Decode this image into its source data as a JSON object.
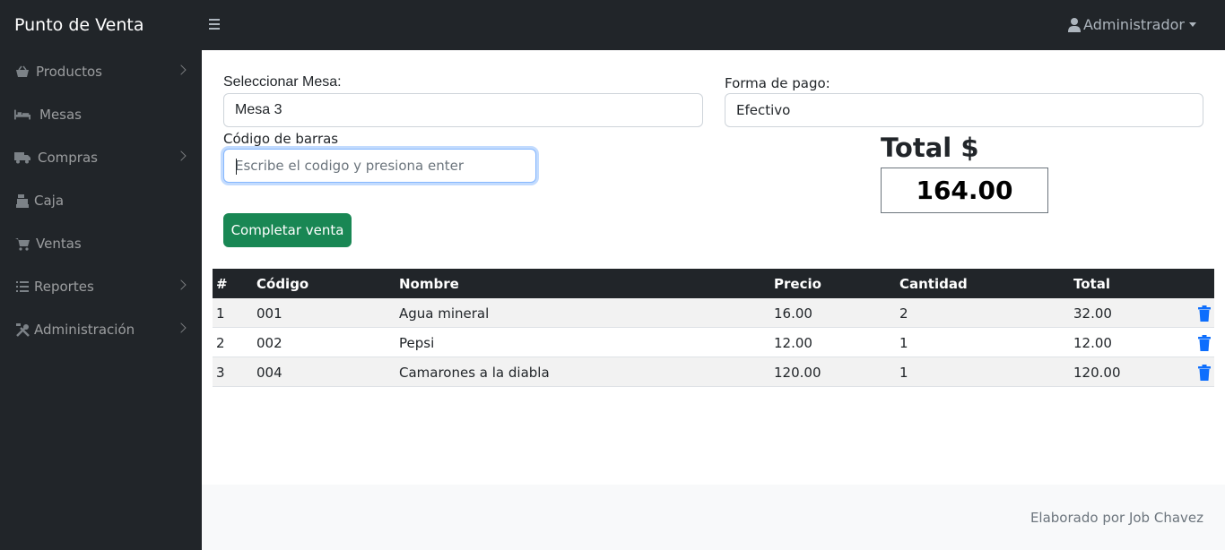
{
  "brand": "Punto de Venta",
  "user": {
    "name": "Administrador",
    "icon": "user-icon"
  },
  "sidebar": {
    "items": [
      {
        "label": "Productos",
        "icon": "basket-icon",
        "has_submenu": true
      },
      {
        "label": "Mesas",
        "icon": "bed-icon",
        "has_submenu": false
      },
      {
        "label": "Compras",
        "icon": "truck-icon",
        "has_submenu": true
      },
      {
        "label": "Caja",
        "icon": "cash-register-icon",
        "has_submenu": false
      },
      {
        "label": "Ventas",
        "icon": "shopping-cart-icon",
        "has_submenu": false
      },
      {
        "label": "Reportes",
        "icon": "list-icon",
        "has_submenu": true
      },
      {
        "label": "Administración",
        "icon": "tools-icon",
        "has_submenu": true
      }
    ]
  },
  "form": {
    "mesa_label": "Seleccionar Mesa:",
    "mesa_value": "Mesa 3",
    "pago_label": "Forma de pago:",
    "pago_value": "Efectivo",
    "barcode_label": "Código de barras",
    "barcode_placeholder": "Escribe el codigo y presiona enter"
  },
  "total": {
    "title": "Total $",
    "value": "164.00"
  },
  "complete_button": "Completar venta",
  "table": {
    "headers": [
      "#",
      "Código",
      "Nombre",
      "Precio",
      "Cantidad",
      "Total"
    ],
    "rows": [
      [
        "1",
        "001",
        "Agua mineral",
        "16.00",
        "2",
        "32.00"
      ],
      [
        "2",
        "002",
        "Pepsi",
        "12.00",
        "1",
        "12.00"
      ],
      [
        "3",
        "004",
        "Camarones a la diabla",
        "120.00",
        "1",
        "120.00"
      ]
    ]
  },
  "footer": "Elaborado por Job Chavez",
  "colors": {
    "sidebar_bg": "#212529",
    "accent_green": "#198754",
    "trash_blue": "#0d6efd"
  }
}
